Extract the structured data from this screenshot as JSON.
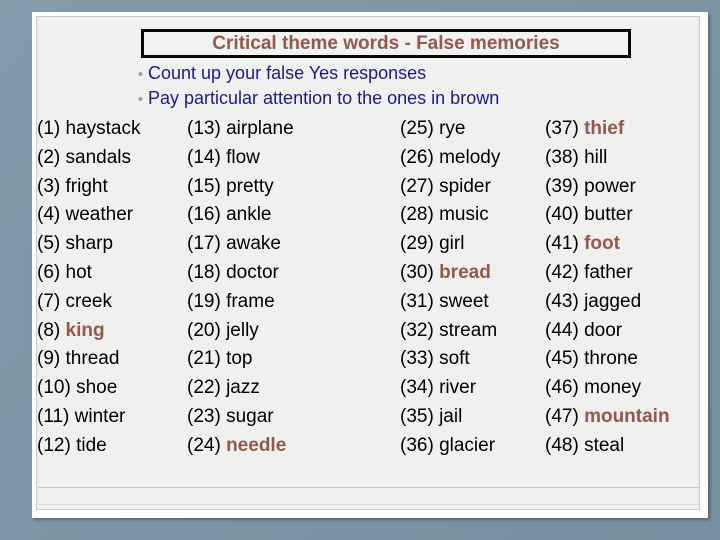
{
  "slide": {
    "title": "Critical theme words - False memories",
    "bullet_marker": "•",
    "bullets": [
      "Count up your false Yes responses",
      "Pay particular attention to the ones in brown"
    ],
    "colors": {
      "title_brown": "#96584a",
      "bullet_navy": "#1a1a8c",
      "highlight_brown": "#96584a",
      "slide_background": "#f0f0ef",
      "backdrop": "#7d96a6"
    },
    "columns": [
      {
        "items": [
          {
            "num": "(1)",
            "word": "haystack",
            "highlight": false
          },
          {
            "num": "(2)",
            "word": "sandals",
            "highlight": false
          },
          {
            "num": "(3)",
            "word": "fright",
            "highlight": false
          },
          {
            "num": "(4)",
            "word": "weather",
            "highlight": false
          },
          {
            "num": "(5)",
            "word": "sharp",
            "highlight": false
          },
          {
            "num": "(6)",
            "word": "hot",
            "highlight": false
          },
          {
            "num": "(7)",
            "word": "creek",
            "highlight": false
          },
          {
            "num": "(8)",
            "word": "king",
            "highlight": true
          },
          {
            "num": "(9)",
            "word": "thread",
            "highlight": false
          },
          {
            "num": "(10)",
            "word": "shoe",
            "highlight": false
          },
          {
            "num": "(11)",
            "word": "winter",
            "highlight": false
          },
          {
            "num": "(12)",
            "word": "tide",
            "highlight": false
          }
        ]
      },
      {
        "items": [
          {
            "num": "(13)",
            "word": "airplane",
            "highlight": false
          },
          {
            "num": "(14)",
            "word": "flow",
            "highlight": false
          },
          {
            "num": "(15)",
            "word": "pretty",
            "highlight": false
          },
          {
            "num": "(16)",
            "word": "ankle",
            "highlight": false
          },
          {
            "num": "(17)",
            "word": "awake",
            "highlight": false
          },
          {
            "num": "(18)",
            "word": "doctor",
            "highlight": false
          },
          {
            "num": "(19)",
            "word": "frame",
            "highlight": false
          },
          {
            "num": "(20)",
            "word": "jelly",
            "highlight": false
          },
          {
            "num": "(21)",
            "word": "top",
            "highlight": false
          },
          {
            "num": "(22)",
            "word": "jazz",
            "highlight": false
          },
          {
            "num": "(23)",
            "word": "sugar",
            "highlight": false
          },
          {
            "num": "(24)",
            "word": "needle",
            "highlight": true
          }
        ]
      },
      {
        "items": [
          {
            "num": "(25)",
            "word": "rye",
            "highlight": false
          },
          {
            "num": "(26)",
            "word": "melody",
            "highlight": false
          },
          {
            "num": "(27)",
            "word": "spider",
            "highlight": false
          },
          {
            "num": "(28)",
            "word": "music",
            "highlight": false
          },
          {
            "num": "(29)",
            "word": "girl",
            "highlight": false
          },
          {
            "num": "(30)",
            "word": "bread",
            "highlight": true
          },
          {
            "num": "(31)",
            "word": "sweet",
            "highlight": false
          },
          {
            "num": "(32)",
            "word": "stream",
            "highlight": false
          },
          {
            "num": "(33)",
            "word": "soft",
            "highlight": false
          },
          {
            "num": "(34)",
            "word": "river",
            "highlight": false
          },
          {
            "num": "(35)",
            "word": "jail",
            "highlight": false
          },
          {
            "num": "(36)",
            "word": "glacier",
            "highlight": false
          }
        ]
      },
      {
        "items": [
          {
            "num": "(37)",
            "word": "thief",
            "highlight": true
          },
          {
            "num": "(38)",
            "word": "hill",
            "highlight": false
          },
          {
            "num": "(39)",
            "word": "power",
            "highlight": false
          },
          {
            "num": "(40)",
            "word": "butter",
            "highlight": false
          },
          {
            "num": "(41)",
            "word": "foot",
            "highlight": true
          },
          {
            "num": "(42)",
            "word": "father",
            "highlight": false
          },
          {
            "num": "(43)",
            "word": "jagged",
            "highlight": false
          },
          {
            "num": "(44)",
            "word": "door",
            "highlight": false
          },
          {
            "num": "(45)",
            "word": "throne",
            "highlight": false
          },
          {
            "num": "(46)",
            "word": "money",
            "highlight": false
          },
          {
            "num": "(47)",
            "word": "mountain",
            "highlight": true
          },
          {
            "num": "(48)",
            "word": "steal",
            "highlight": false
          }
        ]
      }
    ]
  }
}
